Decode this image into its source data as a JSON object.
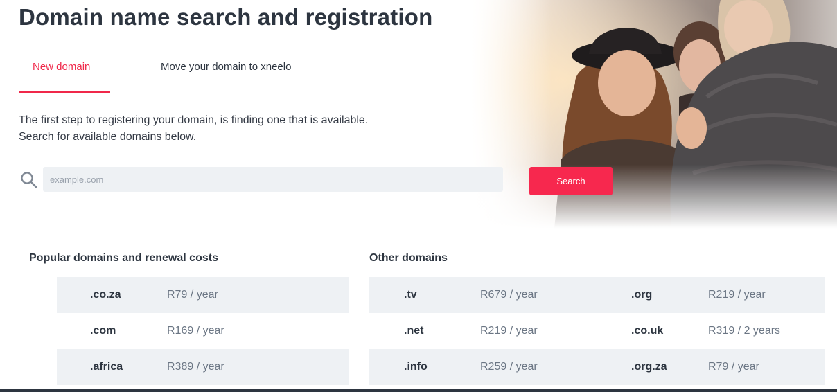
{
  "page": {
    "title": "Domain name search and registration",
    "intro_line1": "The first step to registering your domain, is finding one that is available.",
    "intro_line2": "Search for available domains below."
  },
  "tabs": [
    {
      "label": "New domain",
      "active": true
    },
    {
      "label": "Move your domain to xneelo",
      "active": false
    }
  ],
  "search": {
    "placeholder": "example.com",
    "value": "",
    "button_label": "Search",
    "icon": "search-icon"
  },
  "popular": {
    "heading": "Popular domains and renewal costs",
    "rows": [
      {
        "ext": ".co.za",
        "price": "R79 / year"
      },
      {
        "ext": ".com",
        "price": "R169 / year"
      },
      {
        "ext": ".africa",
        "price": "R389 / year"
      }
    ]
  },
  "other": {
    "heading": "Other domains",
    "rows": [
      {
        "ext1": ".tv",
        "price1": "R679 / year",
        "ext2": ".org",
        "price2": "R219 / year"
      },
      {
        "ext1": ".net",
        "price1": "R219 / year",
        "ext2": ".co.uk",
        "price2": "R319 / 2 years"
      },
      {
        "ext1": ".info",
        "price1": "R259 / year",
        "ext2": ".org.za",
        "price2": "R79 / year"
      }
    ]
  },
  "colors": {
    "accent": "#f7284e",
    "heading": "#2d3540",
    "row_shade": "#eef1f4"
  }
}
